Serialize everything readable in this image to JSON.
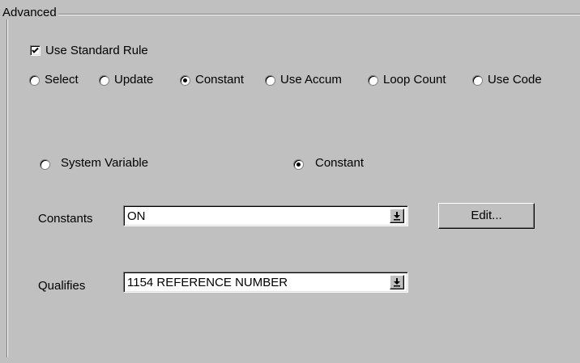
{
  "group": {
    "title": "Advanced"
  },
  "use_standard_rule": {
    "label": "Use Standard Rule",
    "checked": true
  },
  "rule_options": [
    {
      "label": "Select",
      "selected": false
    },
    {
      "label": "Update",
      "selected": false
    },
    {
      "label": "Constant",
      "selected": true
    },
    {
      "label": "Use Accum",
      "selected": false
    },
    {
      "label": "Loop Count",
      "selected": false
    },
    {
      "label": "Use Code",
      "selected": false
    }
  ],
  "source_options": [
    {
      "label": "System Variable",
      "selected": false
    },
    {
      "label": "Constant",
      "selected": true
    }
  ],
  "constants": {
    "label": "Constants",
    "value": "ON",
    "edit_label": "Edit..."
  },
  "qualifies": {
    "label": "Qualifies",
    "value": "1154 REFERENCE NUMBER"
  },
  "colors": {
    "face": "#c0c0c0",
    "window": "#ffffff",
    "shadow": "#808080"
  }
}
